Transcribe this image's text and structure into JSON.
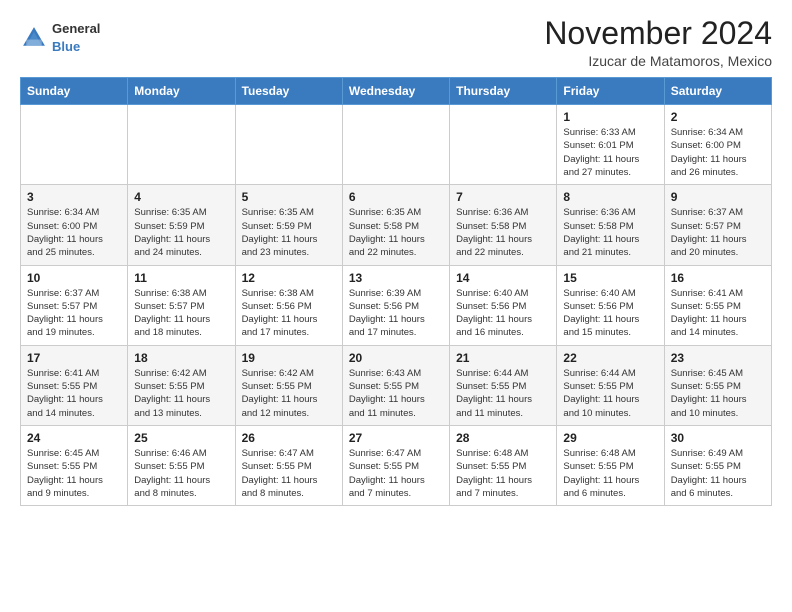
{
  "logo": {
    "general": "General",
    "blue": "Blue"
  },
  "header": {
    "title": "November 2024",
    "subtitle": "Izucar de Matamoros, Mexico"
  },
  "days_of_week": [
    "Sunday",
    "Monday",
    "Tuesday",
    "Wednesday",
    "Thursday",
    "Friday",
    "Saturday"
  ],
  "weeks": [
    [
      {
        "day": "",
        "info": ""
      },
      {
        "day": "",
        "info": ""
      },
      {
        "day": "",
        "info": ""
      },
      {
        "day": "",
        "info": ""
      },
      {
        "day": "",
        "info": ""
      },
      {
        "day": "1",
        "info": "Sunrise: 6:33 AM\nSunset: 6:01 PM\nDaylight: 11 hours and 27 minutes."
      },
      {
        "day": "2",
        "info": "Sunrise: 6:34 AM\nSunset: 6:00 PM\nDaylight: 11 hours and 26 minutes."
      }
    ],
    [
      {
        "day": "3",
        "info": "Sunrise: 6:34 AM\nSunset: 6:00 PM\nDaylight: 11 hours and 25 minutes."
      },
      {
        "day": "4",
        "info": "Sunrise: 6:35 AM\nSunset: 5:59 PM\nDaylight: 11 hours and 24 minutes."
      },
      {
        "day": "5",
        "info": "Sunrise: 6:35 AM\nSunset: 5:59 PM\nDaylight: 11 hours and 23 minutes."
      },
      {
        "day": "6",
        "info": "Sunrise: 6:35 AM\nSunset: 5:58 PM\nDaylight: 11 hours and 22 minutes."
      },
      {
        "day": "7",
        "info": "Sunrise: 6:36 AM\nSunset: 5:58 PM\nDaylight: 11 hours and 22 minutes."
      },
      {
        "day": "8",
        "info": "Sunrise: 6:36 AM\nSunset: 5:58 PM\nDaylight: 11 hours and 21 minutes."
      },
      {
        "day": "9",
        "info": "Sunrise: 6:37 AM\nSunset: 5:57 PM\nDaylight: 11 hours and 20 minutes."
      }
    ],
    [
      {
        "day": "10",
        "info": "Sunrise: 6:37 AM\nSunset: 5:57 PM\nDaylight: 11 hours and 19 minutes."
      },
      {
        "day": "11",
        "info": "Sunrise: 6:38 AM\nSunset: 5:57 PM\nDaylight: 11 hours and 18 minutes."
      },
      {
        "day": "12",
        "info": "Sunrise: 6:38 AM\nSunset: 5:56 PM\nDaylight: 11 hours and 17 minutes."
      },
      {
        "day": "13",
        "info": "Sunrise: 6:39 AM\nSunset: 5:56 PM\nDaylight: 11 hours and 17 minutes."
      },
      {
        "day": "14",
        "info": "Sunrise: 6:40 AM\nSunset: 5:56 PM\nDaylight: 11 hours and 16 minutes."
      },
      {
        "day": "15",
        "info": "Sunrise: 6:40 AM\nSunset: 5:56 PM\nDaylight: 11 hours and 15 minutes."
      },
      {
        "day": "16",
        "info": "Sunrise: 6:41 AM\nSunset: 5:55 PM\nDaylight: 11 hours and 14 minutes."
      }
    ],
    [
      {
        "day": "17",
        "info": "Sunrise: 6:41 AM\nSunset: 5:55 PM\nDaylight: 11 hours and 14 minutes."
      },
      {
        "day": "18",
        "info": "Sunrise: 6:42 AM\nSunset: 5:55 PM\nDaylight: 11 hours and 13 minutes."
      },
      {
        "day": "19",
        "info": "Sunrise: 6:42 AM\nSunset: 5:55 PM\nDaylight: 11 hours and 12 minutes."
      },
      {
        "day": "20",
        "info": "Sunrise: 6:43 AM\nSunset: 5:55 PM\nDaylight: 11 hours and 11 minutes."
      },
      {
        "day": "21",
        "info": "Sunrise: 6:44 AM\nSunset: 5:55 PM\nDaylight: 11 hours and 11 minutes."
      },
      {
        "day": "22",
        "info": "Sunrise: 6:44 AM\nSunset: 5:55 PM\nDaylight: 11 hours and 10 minutes."
      },
      {
        "day": "23",
        "info": "Sunrise: 6:45 AM\nSunset: 5:55 PM\nDaylight: 11 hours and 10 minutes."
      }
    ],
    [
      {
        "day": "24",
        "info": "Sunrise: 6:45 AM\nSunset: 5:55 PM\nDaylight: 11 hours and 9 minutes."
      },
      {
        "day": "25",
        "info": "Sunrise: 6:46 AM\nSunset: 5:55 PM\nDaylight: 11 hours and 8 minutes."
      },
      {
        "day": "26",
        "info": "Sunrise: 6:47 AM\nSunset: 5:55 PM\nDaylight: 11 hours and 8 minutes."
      },
      {
        "day": "27",
        "info": "Sunrise: 6:47 AM\nSunset: 5:55 PM\nDaylight: 11 hours and 7 minutes."
      },
      {
        "day": "28",
        "info": "Sunrise: 6:48 AM\nSunset: 5:55 PM\nDaylight: 11 hours and 7 minutes."
      },
      {
        "day": "29",
        "info": "Sunrise: 6:48 AM\nSunset: 5:55 PM\nDaylight: 11 hours and 6 minutes."
      },
      {
        "day": "30",
        "info": "Sunrise: 6:49 AM\nSunset: 5:55 PM\nDaylight: 11 hours and 6 minutes."
      }
    ]
  ]
}
